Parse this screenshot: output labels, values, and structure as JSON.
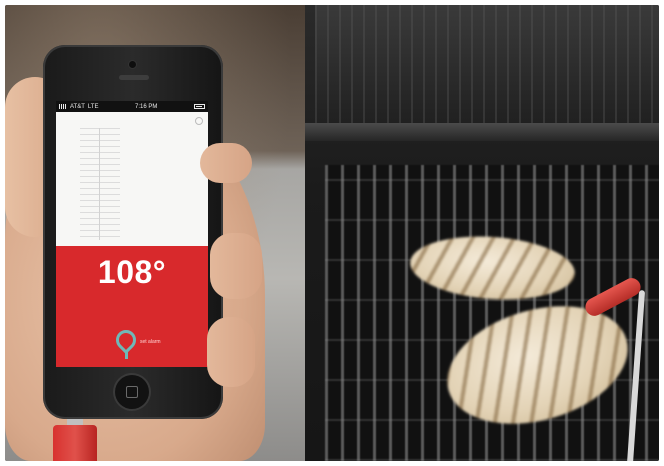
{
  "phone_app": {
    "status_bar": {
      "carrier": "AT&T",
      "network": "LTE",
      "time": "7:16 PM"
    },
    "temperature": "108°",
    "alarm_label": "set alarm"
  },
  "colors": {
    "temp_panel": "#d8292c",
    "pin_accent": "#6fb8b8",
    "probe": "#d8322f"
  },
  "icons": {
    "settings": "gear-icon",
    "alarm": "map-pin-icon",
    "battery": "battery-icon",
    "signal": "signal-icon"
  }
}
